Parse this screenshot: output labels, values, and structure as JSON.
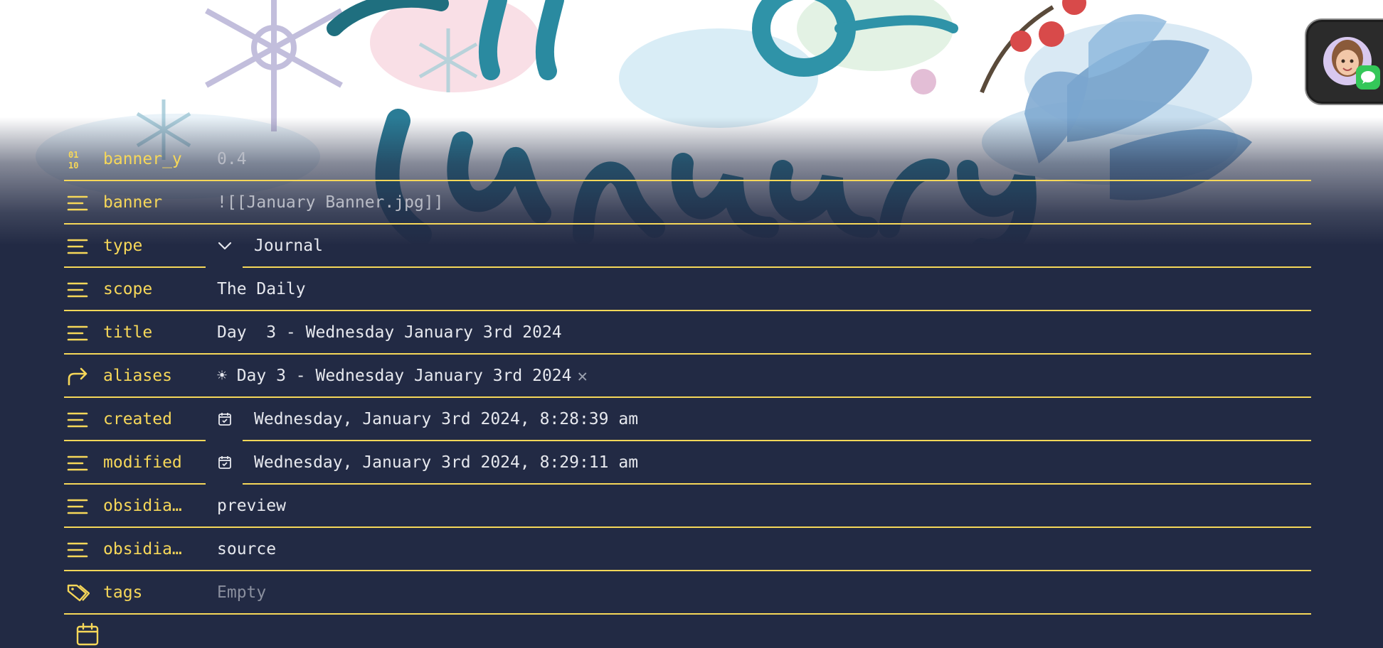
{
  "properties": [
    {
      "key": "banner_y",
      "value": "0.4",
      "icon": "number-icon"
    },
    {
      "key": "banner",
      "value": "![[January Banner.jpg]]",
      "icon": "text-lines-icon"
    },
    {
      "key": "type",
      "value": "Journal",
      "icon": "text-lines-icon"
    },
    {
      "key": "scope",
      "value": "The Daily",
      "icon": "text-lines-icon"
    },
    {
      "key": "title",
      "value": "Day  3 - Wednesday January 3rd 2024",
      "icon": "text-lines-icon"
    },
    {
      "key": "aliases",
      "value": "☀ Day 3 - Wednesday January 3rd 2024",
      "remove": "✕",
      "icon": "forward-arrow-icon"
    },
    {
      "key": "created",
      "value": "Wednesday, January 3rd 2024, 8:28:39 am",
      "icon": "text-lines-icon"
    },
    {
      "key": "modified",
      "value": "Wednesday, January 3rd 2024, 8:29:11 am",
      "icon": "text-lines-icon"
    },
    {
      "key": "obsidia…",
      "value": "preview",
      "icon": "text-lines-icon"
    },
    {
      "key": "obsidia…",
      "value": "source",
      "icon": "text-lines-icon"
    },
    {
      "key": "tags",
      "value": "Empty",
      "icon": "tag-icon"
    }
  ],
  "colors": {
    "background": "#222a44",
    "accent": "#f6d759",
    "text": "#e6e8ee",
    "muted": "#8a8f9e"
  },
  "icons": {
    "add_property": "calendar-icon",
    "avatar_badge": "messages-icon"
  }
}
